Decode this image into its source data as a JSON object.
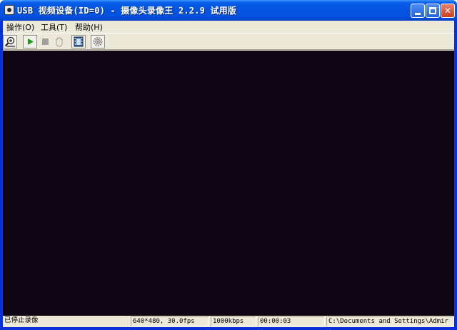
{
  "window": {
    "title": "USB 视频设备(ID=0) - 摄像头录像王 2.2.9 试用版"
  },
  "menu": [
    {
      "label": "操作(O)"
    },
    {
      "label": "工具(T)"
    },
    {
      "label": "帮助(H)"
    }
  ],
  "toolbar": {
    "icons": [
      "camera-search-icon",
      "play-icon",
      "stop-icon",
      "pause-hand-icon",
      "film-icon",
      "settings-gear-icon"
    ],
    "colors": {
      "play": "#1a9a1a",
      "disabled": "#a0a0a0"
    }
  },
  "video": {
    "background": "#0e0412"
  },
  "status": {
    "state": "已停止录像",
    "resolution": "640*480, 30.0fps",
    "bitrate": "1000kbps",
    "time": "00:00:03",
    "path": "C:\\Documents and Settings\\Admir"
  }
}
